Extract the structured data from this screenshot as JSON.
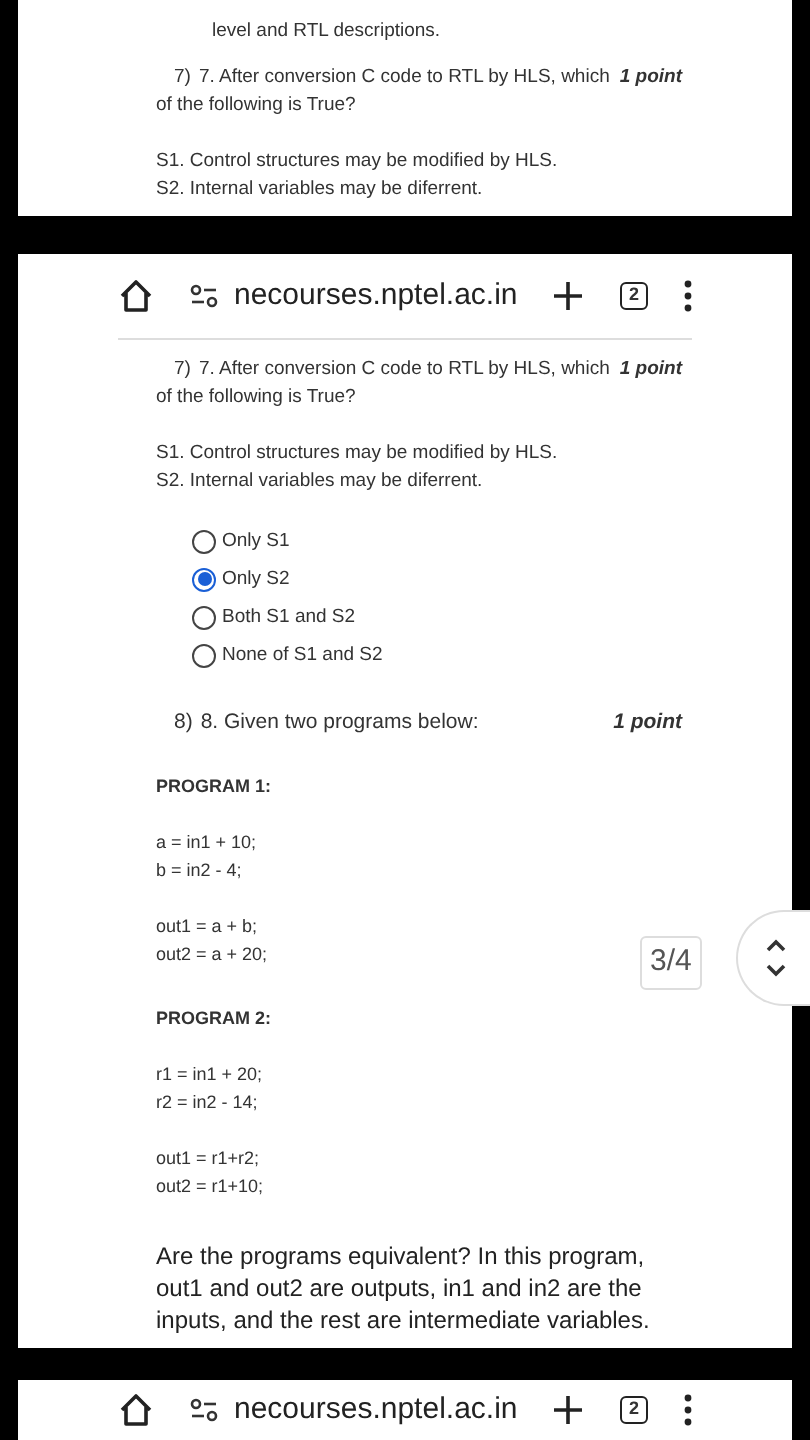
{
  "panels": [
    {
      "kind": "page",
      "lines": [
        "level and RTL descriptions."
      ],
      "questions": [
        {
          "number": "7)",
          "text": "7. After conversion C code to RTL by HLS, which of the following is True?",
          "points": "1 point",
          "statements": [
            "S1. Control structures may be modified by HLS.",
            "S2. Internal variables may be diferrent."
          ]
        }
      ]
    },
    {
      "kind": "browser",
      "toolbar": {
        "url": "necourses.nptel.ac.in",
        "tab_count": "2"
      },
      "questions": [
        {
          "number": "7)",
          "text": "7. After conversion C code to RTL by HLS, which of the following is True?",
          "points": "1 point",
          "statements": [
            "S1. Control structures may be modified by HLS.",
            "S2. Internal variables may be diferrent."
          ],
          "options": [
            {
              "label": "Only S1",
              "selected": false
            },
            {
              "label": "Only S2",
              "selected": true
            },
            {
              "label": "Both S1 and S2",
              "selected": false
            },
            {
              "label": "None of S1 and S2",
              "selected": false
            }
          ]
        },
        {
          "number": "8)",
          "text": "8. Given two programs below:",
          "points": "1 point",
          "programs": [
            {
              "heading": "PROGRAM 1:",
              "groups": [
                [
                  "a = in1 + 10;",
                  "b = in2 - 4;"
                ],
                [
                  "out1 = a + b;",
                  "out2 = a + 20;"
                ]
              ]
            },
            {
              "heading": "PROGRAM 2:",
              "groups": [
                [
                  "r1 = in1 + 20;",
                  "r2 = in2 - 14;"
                ],
                [
                  "out1 = r1+r2;",
                  "out2 = r1+10;"
                ]
              ]
            }
          ],
          "footer": "Are the programs equivalent? In this program, out1 and out2 are outputs, in1 and in2 are the inputs, and the rest are intermediate variables."
        }
      ],
      "page_indicator": "3/4"
    },
    {
      "kind": "browser",
      "toolbar": {
        "url": "necourses.nptel.ac.in",
        "tab_count": "2"
      }
    }
  ]
}
